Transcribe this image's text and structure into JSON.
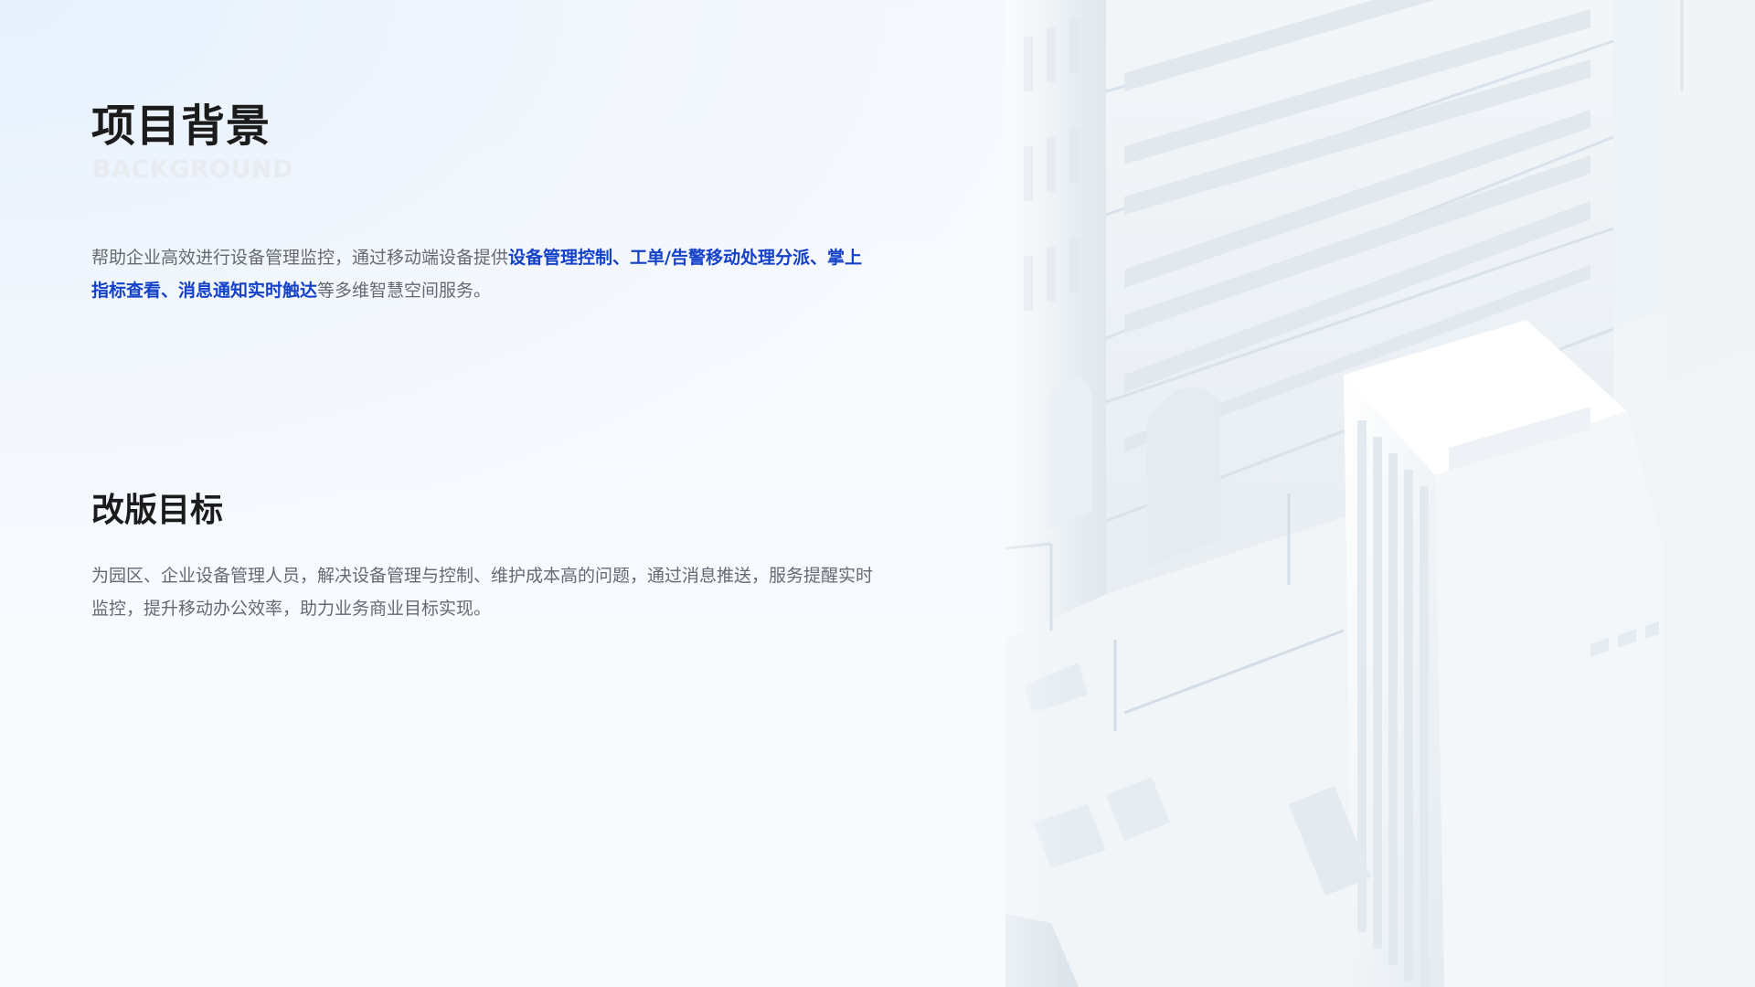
{
  "background": {
    "title": "项目背景",
    "subtitle": "BACKGROUND",
    "paragraph": {
      "part1": "帮助企业高效进行设备管理监控，通过移动端设备提供",
      "highlight1": "设备管理控制、工单/告警移动处理分派、",
      "highlight2": "掌上指标查看、消息通知实时触达",
      "part2": "等多维智慧空间服务。"
    }
  },
  "goal": {
    "title": "改版目标",
    "paragraph": "为园区、企业设备管理人员，解决设备管理与控制、维护成本高的问题，通过消息推送，服务提醒实时监控，提升移动办公效率，助力业务商业目标实现。"
  },
  "colors": {
    "highlight": "#1441c8",
    "title": "#1b1b1b",
    "body_text": "#666a70",
    "subtitle": "#e8ecf1"
  },
  "illustration": {
    "icon": "isometric-white-city-buildings"
  }
}
